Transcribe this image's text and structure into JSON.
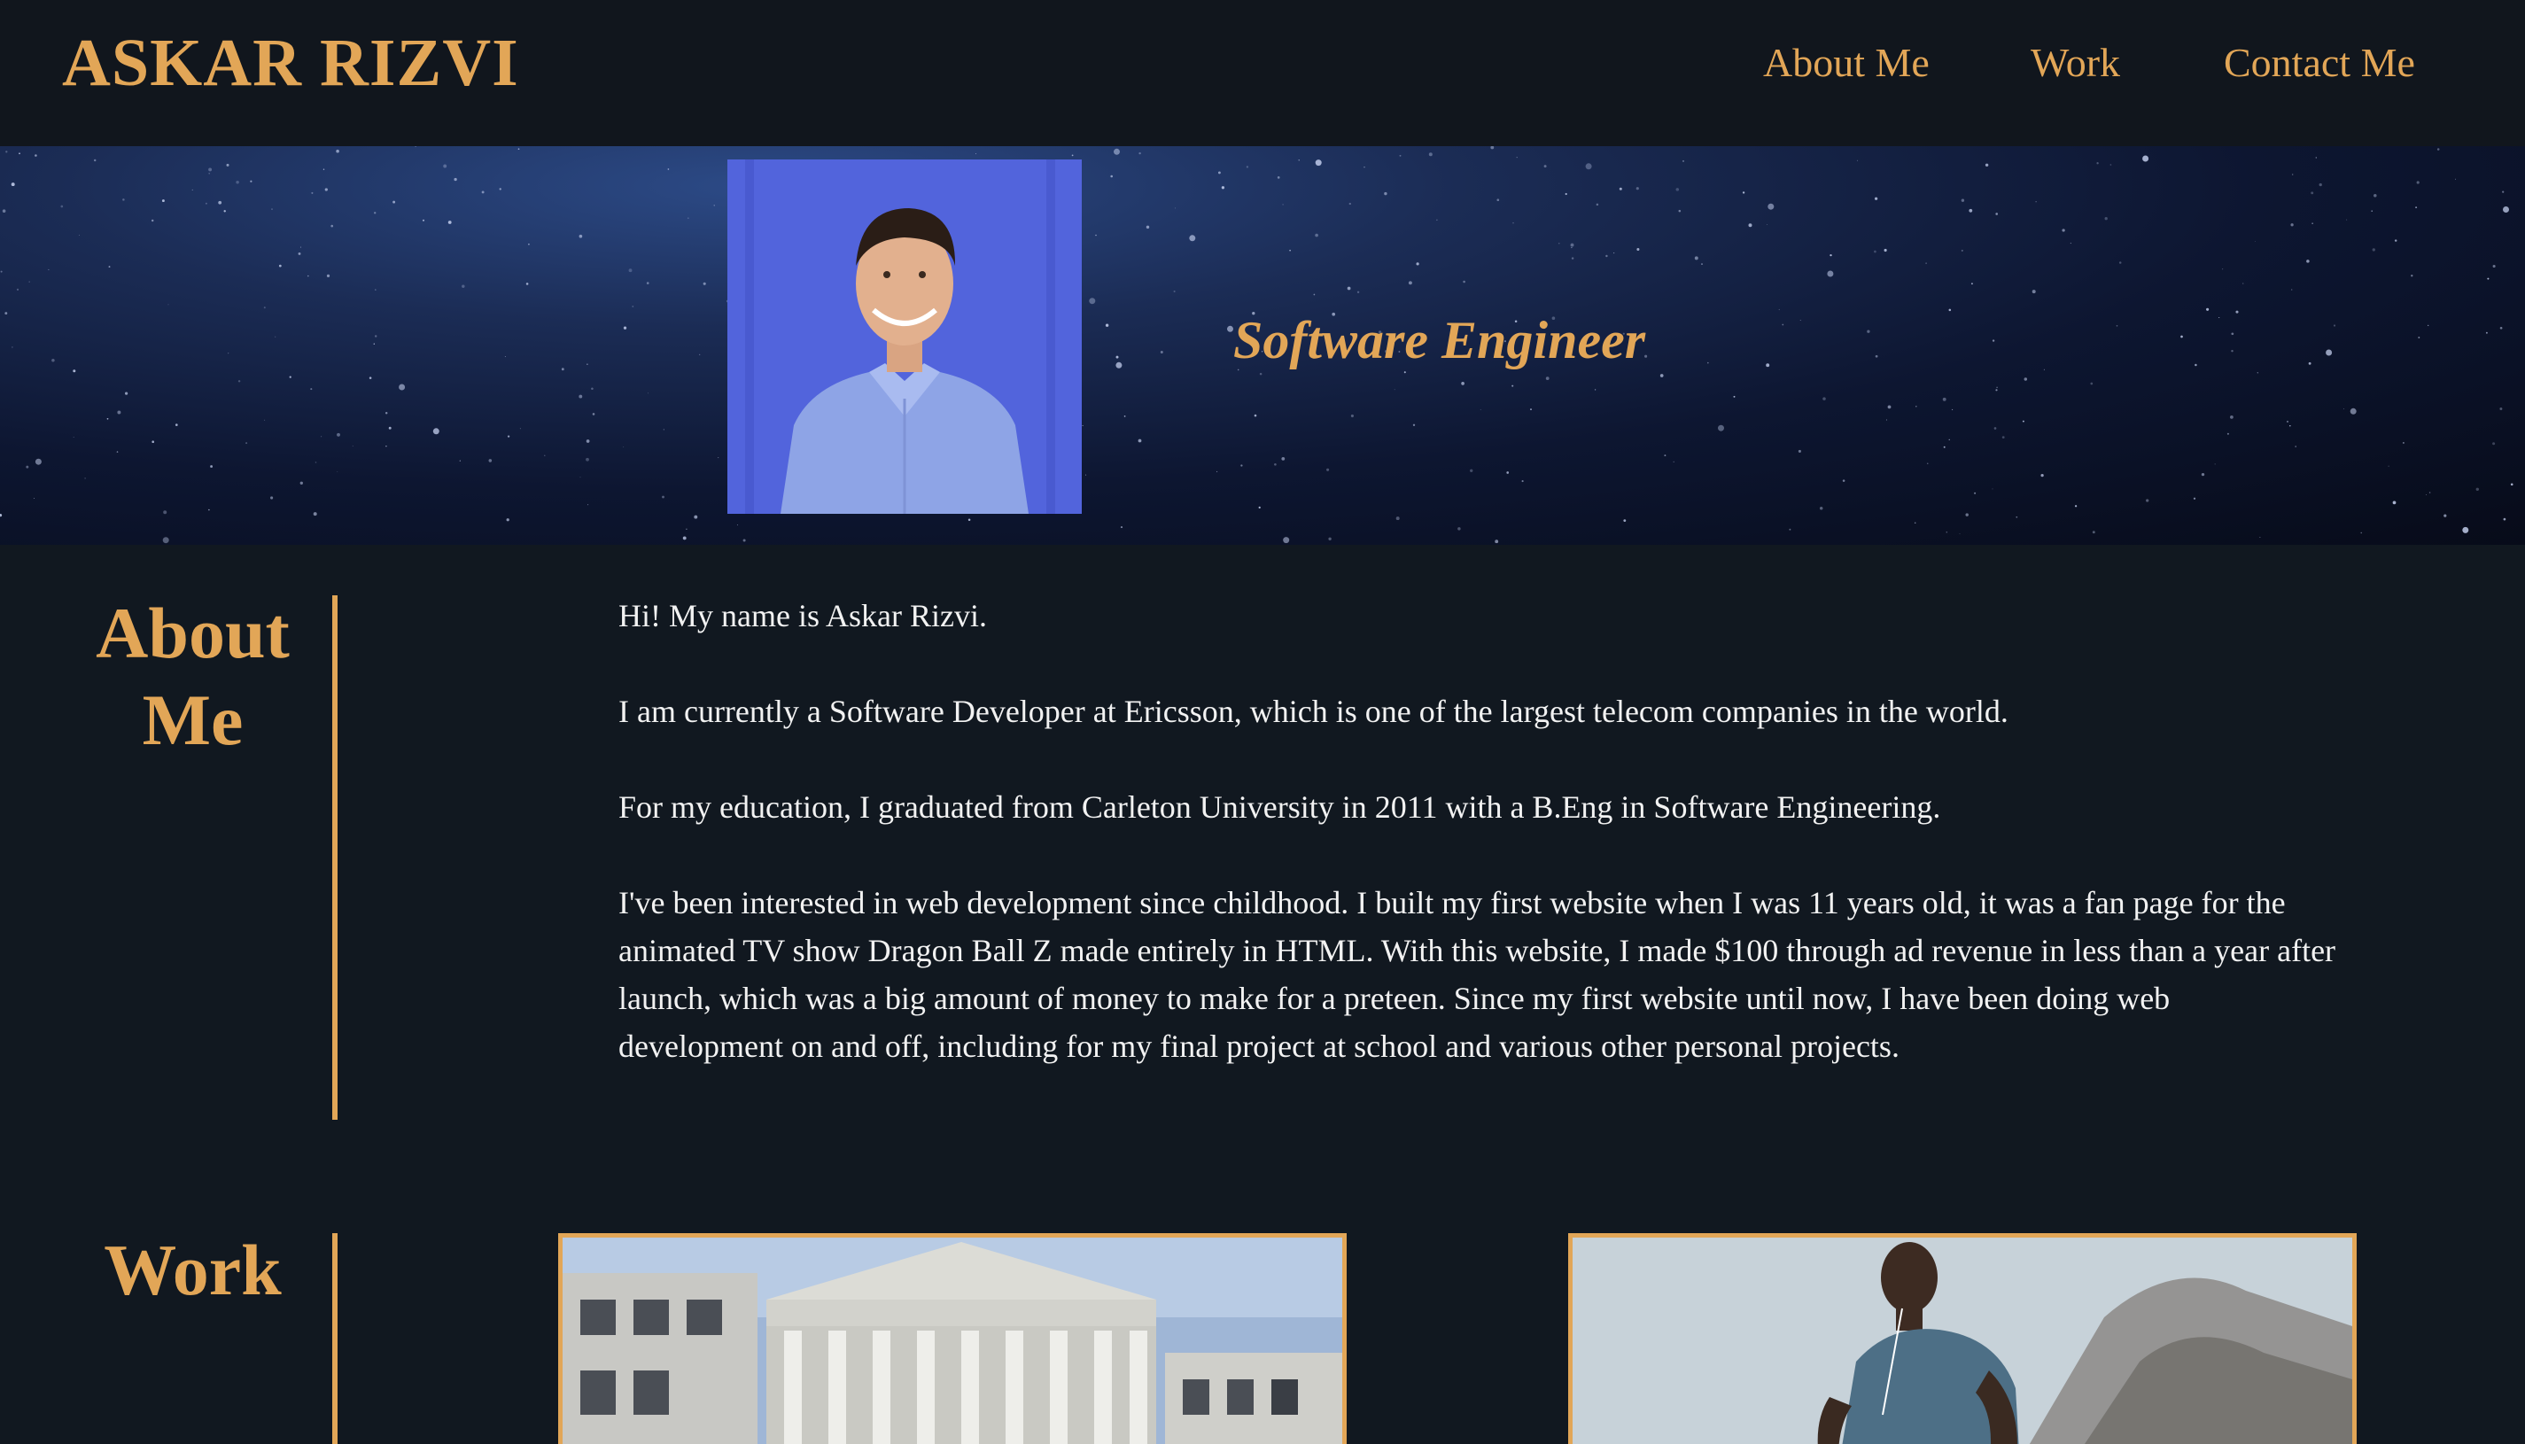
{
  "header": {
    "brand": "ASKAR RIZVI",
    "nav": {
      "about": "About Me",
      "work": "Work",
      "contact": "Contact Me"
    }
  },
  "hero": {
    "tagline": "Software Engineer",
    "photo_icon": "profile-photo"
  },
  "about": {
    "heading_line1": "About",
    "heading_line2": "Me",
    "paragraphs": [
      "Hi! My name is Askar Rizvi.",
      "I am currently a Software Developer at Ericsson, which is one of the largest telecom companies in the world.",
      "For my education, I graduated from Carleton University in 2011 with a B.Eng in Software Engineering.",
      "I've been interested in web development since childhood. I built my first website when I was 11 years old, it was a fan page for the animated TV show Dragon Ball Z made entirely in HTML. With this website, I made $100 through ad revenue in less than a year after launch, which was a big amount of money to make for a preteen. Since my first website until now, I have been doing web development on and off, including for my final project at school and various other personal projects."
    ]
  },
  "work": {
    "heading": "Work",
    "cards": [
      {
        "image_icon": "bank-building-image"
      },
      {
        "image_icon": "runner-image"
      }
    ]
  },
  "colors": {
    "accent": "#e2a657",
    "background": "#111820",
    "header": "#11161d",
    "text": "#f2f2f2"
  }
}
